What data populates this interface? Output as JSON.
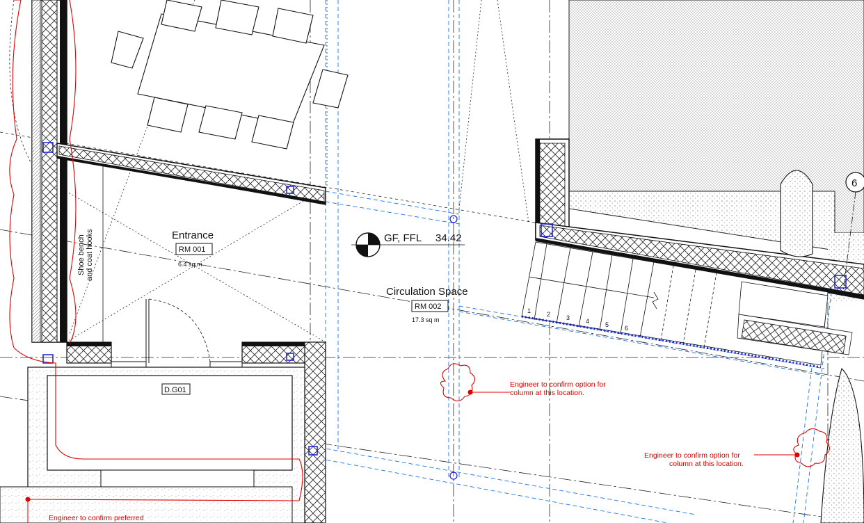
{
  "rooms": {
    "entrance": {
      "name": "Entrance",
      "number": "RM 001",
      "area": "6.4 sq m"
    },
    "circulation": {
      "name": "Circulation Space",
      "number": "RM 002",
      "area": "17.3 sq m"
    }
  },
  "level": {
    "marker": "GF, FFL",
    "value": "34.42"
  },
  "furniture_note": {
    "line1": "Shoe bench",
    "line2": "and coat hooks"
  },
  "door_tag": "D.G01",
  "grid_bubble": "6",
  "stair_steps": [
    "1",
    "2",
    "3",
    "4",
    "5",
    "6"
  ],
  "engineer_notes": {
    "note1": {
      "line1": "Engineer to confirm option for",
      "line2": "column at this location."
    },
    "note2": {
      "line1": "Engineer to confirm option for",
      "line2": "column at this location."
    },
    "note3": {
      "line1": "Engineer to confirm preferred"
    }
  },
  "colors": {
    "markup": "#e00000",
    "construction": "#1a73e8",
    "ink": "#111111"
  },
  "icons": {
    "level_marker": "datum-target-icon",
    "cloud": "revision-cloud-icon"
  }
}
